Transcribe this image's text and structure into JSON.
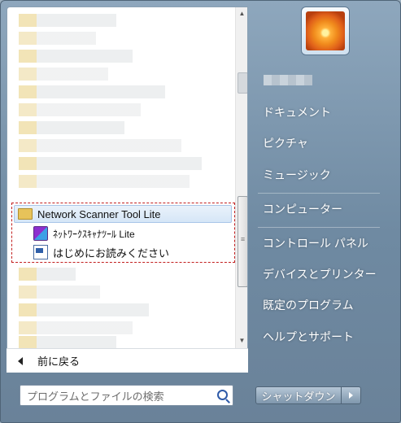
{
  "programs_list": {
    "folder_label": "Network Scanner Tool Lite",
    "sub_items": [
      {
        "label": "ﾈｯﾄﾜｰｸｽｷｬﾅﾂｰﾙ Lite",
        "icon": "scanner-app-icon"
      },
      {
        "label": "はじめにお読みください",
        "icon": "readme-document-icon"
      }
    ],
    "back_label": "前に戻る"
  },
  "search": {
    "placeholder": "プログラムとファイルの検索"
  },
  "right_pane": {
    "items": [
      "ドキュメント",
      "ピクチャ",
      "ミュージック",
      "コンピューター",
      "コントロール パネル",
      "デバイスとプリンター",
      "既定のプログラム",
      "ヘルプとサポート"
    ]
  },
  "shutdown_label": "シャットダウン",
  "colors": {
    "highlight_box": "#c21f1f",
    "menu_bg": "#7f97ad"
  }
}
